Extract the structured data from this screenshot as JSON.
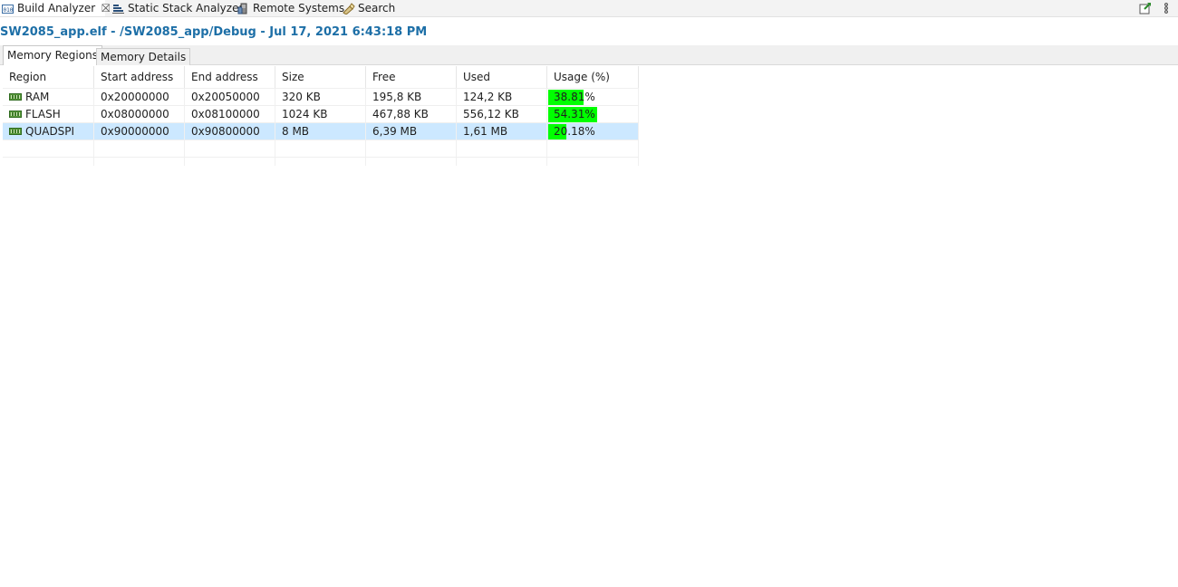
{
  "view_tabs": [
    {
      "label": "Build Analyzer",
      "icon": "binary-icon",
      "active": true,
      "close": "⛝"
    },
    {
      "label": "Static Stack Analyzer",
      "icon": "stack-icon"
    },
    {
      "label": "Remote Systems",
      "icon": "server-icon"
    },
    {
      "label": "Search",
      "icon": "flashlight-icon"
    }
  ],
  "toolbar_icons": [
    "pin-view-icon",
    "view-menu-icon"
  ],
  "title": "SW2085_app.elf - /SW2085_app/Debug - Jul 17, 2021 6:43:18 PM",
  "inner_tabs": {
    "memory_regions": "Memory Regions",
    "memory_details": "Memory Details"
  },
  "table": {
    "columns": [
      "Region",
      "Start address",
      "End address",
      "Size",
      "Free",
      "Used",
      "Usage (%)"
    ],
    "rows": [
      {
        "region": "RAM",
        "start": "0x20000000",
        "end": "0x20050000",
        "size": "320 KB",
        "free": "195,8 KB",
        "used": "124,2 KB",
        "usage": "38.81%",
        "usage_value": 38.81
      },
      {
        "region": "FLASH",
        "start": "0x08000000",
        "end": "0x08100000",
        "size": "1024 KB",
        "free": "467,88 KB",
        "used": "556,12 KB",
        "usage": "54.31%",
        "usage_value": 54.31
      },
      {
        "region": "QUADSPI",
        "start": "0x90000000",
        "end": "0x90800000",
        "size": "8 MB",
        "free": "6,39 MB",
        "used": "1,61 MB",
        "usage": "20.18%",
        "usage_value": 20.18,
        "selected": true
      }
    ]
  },
  "colors": {
    "usage_bar": "#00ff00",
    "selection": "#cce8ff",
    "title": "#1d6fa7"
  }
}
